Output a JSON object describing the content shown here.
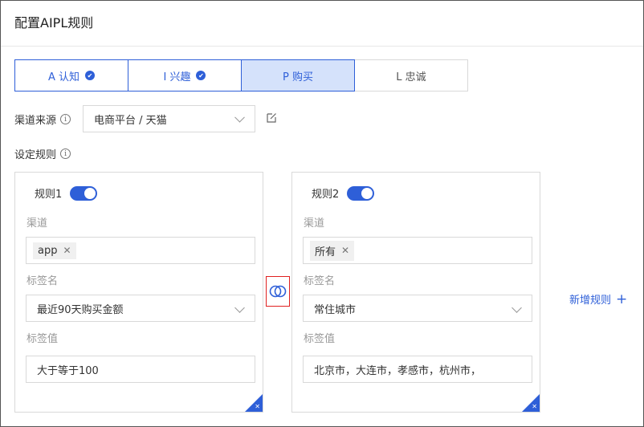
{
  "page": {
    "title": "配置AIPL规则"
  },
  "steps": [
    {
      "label": "A 认知",
      "state": "done"
    },
    {
      "label": "I 兴趣",
      "state": "done"
    },
    {
      "label": "P 购买",
      "state": "active"
    },
    {
      "label": "L 忠诚",
      "state": "pending"
    }
  ],
  "channel_source": {
    "label": "渠道来源",
    "value": "电商平台 / 天猫"
  },
  "set_rules": {
    "label": "设定规则"
  },
  "rules": [
    {
      "name": "规则1",
      "enabled": true,
      "channel_label": "渠道",
      "channel_tag": "app",
      "tag_name_label": "标签名",
      "tag_name_value": "最近90天购买金额",
      "tag_value_label": "标签值",
      "tag_value": "大于等于100"
    },
    {
      "name": "规则2",
      "enabled": true,
      "channel_label": "渠道",
      "channel_tag": "所有",
      "tag_name_label": "标签名",
      "tag_name_value": "常住城市",
      "tag_value_label": "标签值",
      "tag_value": "北京市，大连市，孝感市，杭州市，"
    }
  ],
  "actions": {
    "add_rule": "新增规则"
  },
  "colors": {
    "accent": "#2e5fd8",
    "active_bg": "#d5e2fb",
    "highlight": "#e02020"
  },
  "icons": {
    "check": "check-circle-icon",
    "info": "info-icon",
    "edit": "edit-icon",
    "link": "intersect-icon",
    "plus": "plus-icon",
    "close": "close-icon",
    "chevron": "chevron-down-icon"
  }
}
